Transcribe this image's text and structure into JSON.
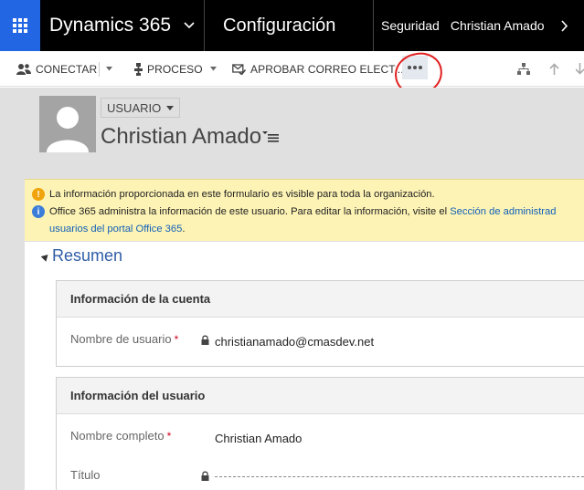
{
  "topbar": {
    "app_title": "Dynamics 365",
    "area_title": "Configuración",
    "breadcrumb": [
      "Seguridad",
      "Christian Amado"
    ],
    "colors": {
      "bg": "#000000",
      "waffle": "#2266e3"
    }
  },
  "commands": {
    "connect": "CONECTAR",
    "process": "PROCESO",
    "approve_email": "APROBAR CORREO ELECT..."
  },
  "header": {
    "user_type": "USUARIO",
    "user_name": "Christian Amado"
  },
  "notifications": {
    "warning": "La información proporcionada en este formulario es visible para toda la organización.",
    "info_text": "Office 365 administra la información de este usuario. Para editar la información, visite el ",
    "info_link_1": "Sección de administrad",
    "info_link_2": "usuarios del portal Office 365",
    "info_end": "."
  },
  "summary": {
    "title": "Resumen",
    "account": {
      "heading": "Información de la cuenta",
      "username_label": "Nombre de usuario",
      "username_value": "christianamado@cmasdev.net"
    },
    "user": {
      "heading": "Información del usuario",
      "fullname_label": "Nombre completo",
      "fullname_value": "Christian Amado",
      "title_label": "Título"
    }
  },
  "icons": [
    "waffle-icon",
    "chevron-down-icon",
    "chevron-right-icon",
    "connect-icon",
    "process-icon",
    "approve-email-icon",
    "more-icon",
    "hierarchy-icon",
    "arrow-up-icon",
    "arrow-down-icon",
    "view-selector-icon",
    "warning-icon",
    "info-icon",
    "lock-icon",
    "collapse-icon",
    "avatar-placeholder-icon"
  ]
}
